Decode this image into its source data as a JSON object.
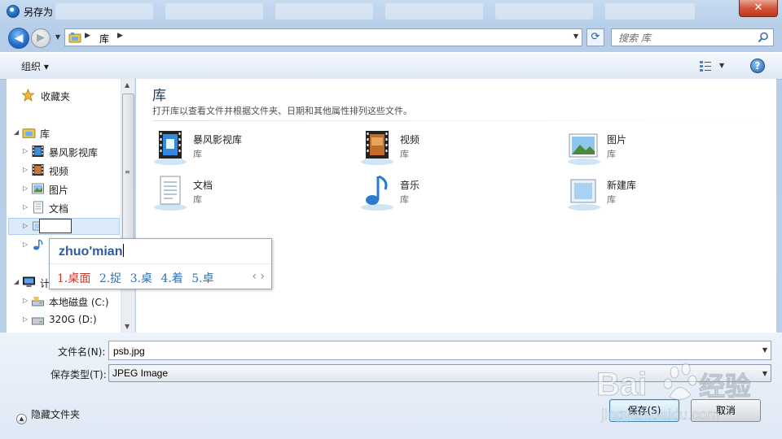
{
  "window": {
    "title": "另存为",
    "close_label": "✕"
  },
  "address": {
    "segments": [
      "库"
    ]
  },
  "search": {
    "placeholder": "搜索 库"
  },
  "toolbar": {
    "organize_label": "组织 ▾"
  },
  "nav": {
    "items": [
      {
        "label": "收藏夹",
        "icon": "star-icon"
      },
      {
        "label": "库",
        "icon": "library-icon"
      },
      {
        "label": "暴风影视库",
        "icon": "video-library-icon"
      },
      {
        "label": "视频",
        "icon": "video-icon"
      },
      {
        "label": "图片",
        "icon": "picture-icon"
      },
      {
        "label": "文档",
        "icon": "document-icon"
      },
      {
        "label": "",
        "icon": "new-library-icon"
      },
      {
        "label": "",
        "icon": "music-icon"
      },
      {
        "label": "计",
        "icon": "computer-icon"
      },
      {
        "label": "本地磁盘 (C:)",
        "icon": "drive-icon"
      },
      {
        "label": "320G (D:)",
        "icon": "drive-icon"
      }
    ]
  },
  "content": {
    "title": "库",
    "subtitle": "打开库以查看文件并根据文件夹、日期和其他属性排列这些文件。",
    "libraries": [
      {
        "name": "暴风影视库",
        "type": "库",
        "icon": "video-library-icon"
      },
      {
        "name": "视频",
        "type": "库",
        "icon": "video-icon"
      },
      {
        "name": "图片",
        "type": "库",
        "icon": "picture-icon"
      },
      {
        "name": "文档",
        "type": "库",
        "icon": "document-icon"
      },
      {
        "name": "音乐",
        "type": "库",
        "icon": "music-icon"
      },
      {
        "name": "新建库",
        "type": "库",
        "icon": "new-library-icon"
      }
    ]
  },
  "ime": {
    "composition": "zhuo'mian",
    "candidates": [
      "1.桌面",
      "2.捉",
      "3.桌",
      "4.着",
      "5.卓"
    ],
    "nav": "‹ ›"
  },
  "form": {
    "filename_label": "文件名(N):",
    "filename_value": "psb.jpg",
    "filetype_label": "保存类型(T):",
    "filetype_value": "JPEG Image",
    "hide_folders_label": "隐藏文件夹",
    "save_label": "保存(S)",
    "cancel_label": "取消"
  },
  "watermark": {
    "brand": "Bai",
    "brand_cn": "经验",
    "url": "jingyan.baidu.com"
  }
}
